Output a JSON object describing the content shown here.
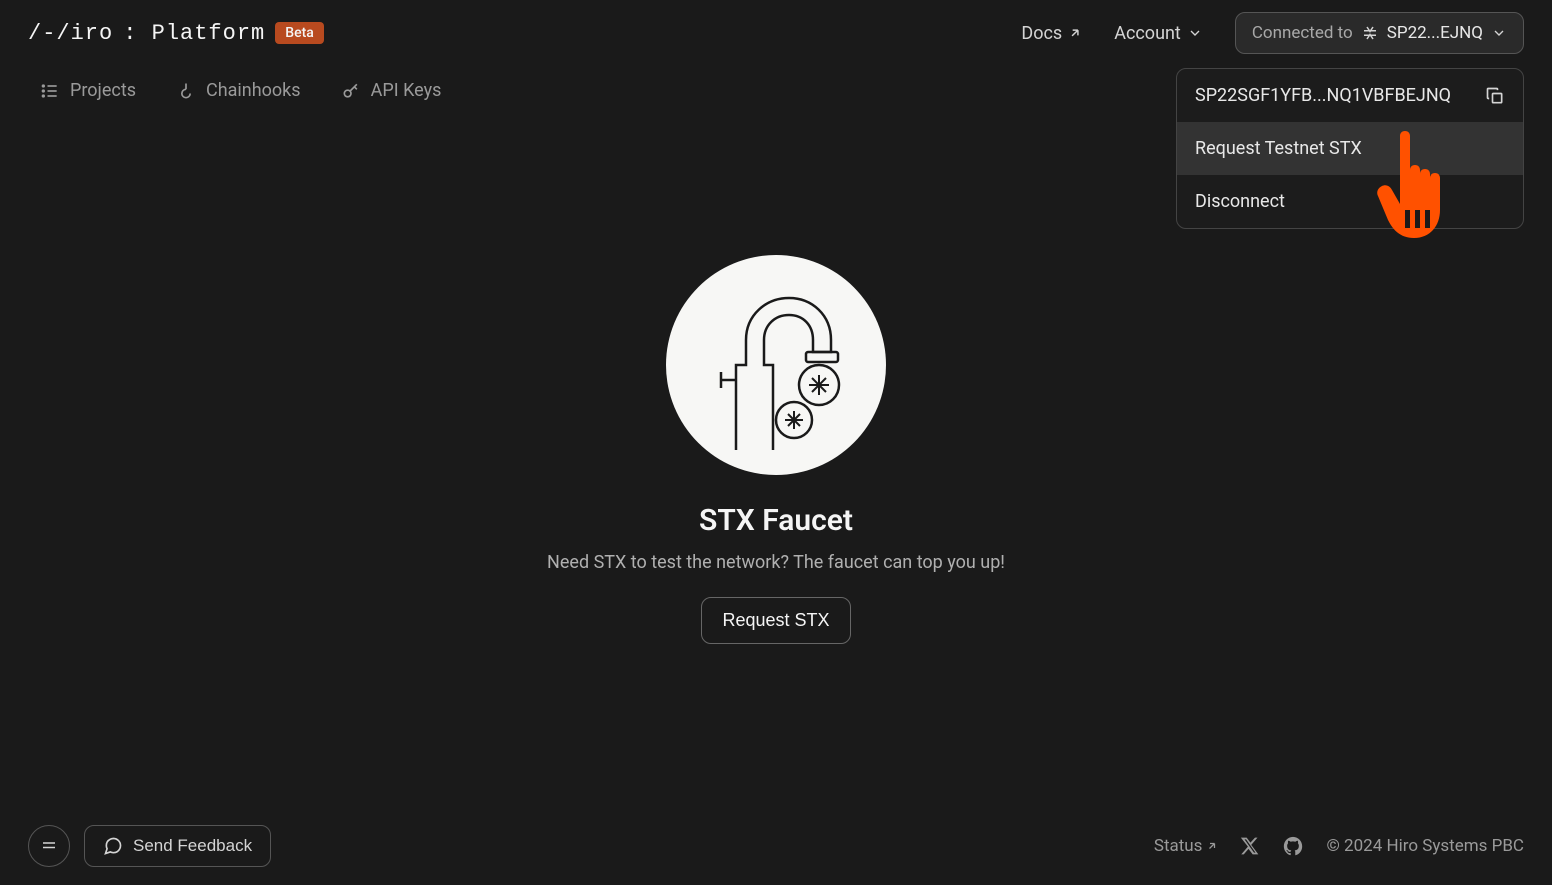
{
  "header": {
    "logo_prefix": "/-/iro",
    "logo_suffix": ": Platform",
    "beta": "Beta",
    "docs": "Docs",
    "account": "Account",
    "connected_label": "Connected to",
    "wallet_short": "SP22...EJNQ"
  },
  "dropdown": {
    "wallet_full": "SP22SGF1YFB...NQ1VBFBEJNQ",
    "request_testnet": "Request Testnet STX",
    "disconnect": "Disconnect"
  },
  "nav": {
    "projects": "Projects",
    "chainhooks": "Chainhooks",
    "api_keys": "API Keys"
  },
  "main": {
    "title": "STX Faucet",
    "subtitle": "Need STX to test the network? The faucet can top you up!",
    "request_btn": "Request STX"
  },
  "footer": {
    "feedback": "Send Feedback",
    "status": "Status",
    "copyright": "© 2024 Hiro Systems PBC"
  }
}
